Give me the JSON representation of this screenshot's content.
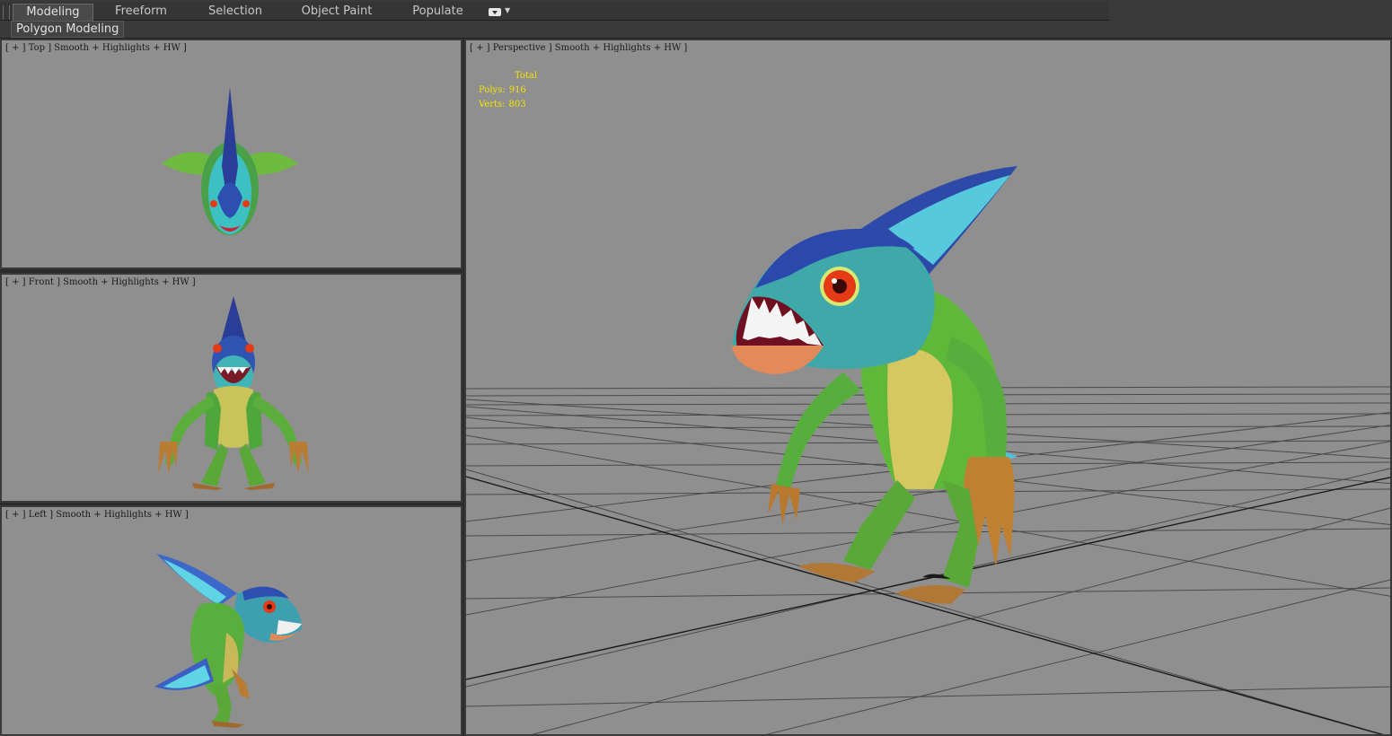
{
  "ribbon": {
    "tabs": [
      {
        "label": "Modeling",
        "active": true
      },
      {
        "label": "Freeform",
        "active": false
      },
      {
        "label": "Selection",
        "active": false
      },
      {
        "label": "Object Paint",
        "active": false
      },
      {
        "label": "Populate",
        "active": false
      }
    ],
    "panel_label": "Polygon Modeling"
  },
  "viewports": {
    "top": {
      "label": "[ + ] Top ] Smooth + Highlights + HW ]"
    },
    "front": {
      "label": "[ + ] Front ] Smooth + Highlights + HW ]"
    },
    "left": {
      "label": "[ + ] Left ] Smooth + Highlights + HW ]"
    },
    "perspective": {
      "label": "[ + ] Perspective ] Smooth + Highlights + HW ]",
      "stats": {
        "header": "Total",
        "polys_label": "Polys:",
        "polys_value": "916",
        "verts_label": "Verts:",
        "verts_value": "803"
      }
    }
  },
  "colors": {
    "viewport_bg": "#8f8f8f",
    "stats_text": "#f5e400",
    "creature_green": "#5fb83a",
    "creature_blue": "#2a4fa8",
    "creature_cyan": "#4cd6e0",
    "creature_eye": "#e43a16"
  }
}
